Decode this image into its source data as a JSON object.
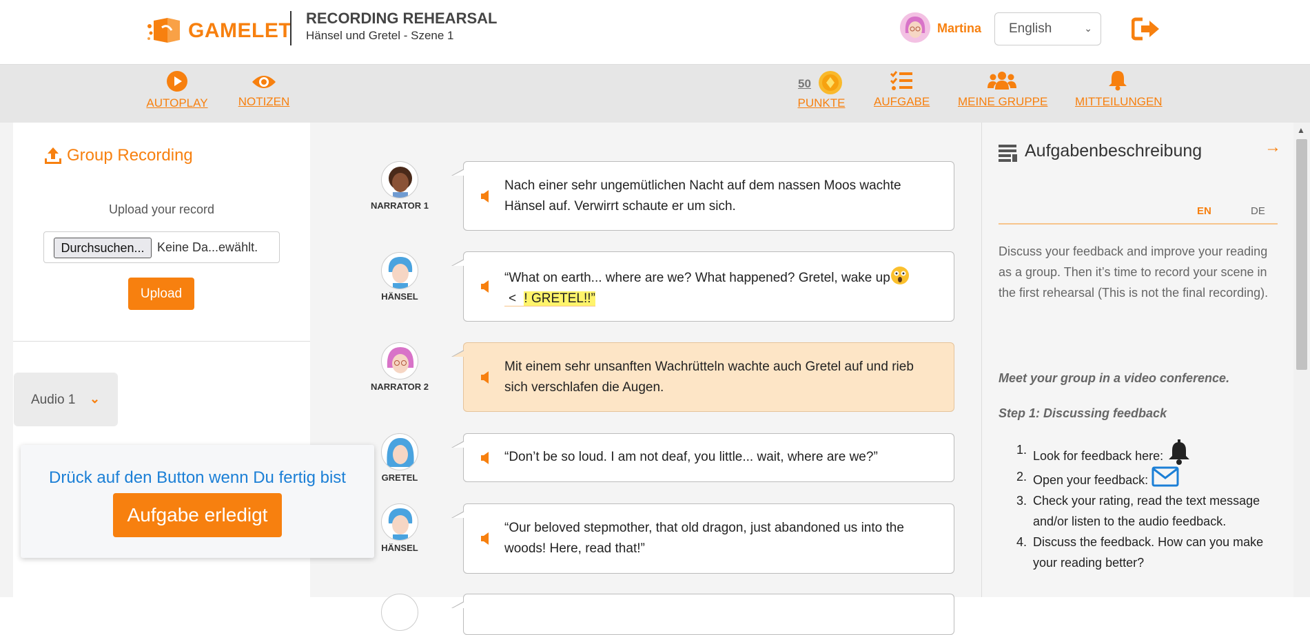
{
  "header": {
    "logo_text": "GAMELET",
    "title": "RECORDING REHEARSAL",
    "subtitle": "Hänsel und Gretel - Szene 1",
    "user_name": "Martina",
    "language": "English"
  },
  "nav": {
    "autoplay": "AUTOPLAY",
    "notes": "NOTIZEN",
    "points_value": "50",
    "points": "PUNKTE",
    "task": "AUFGABE",
    "group": "MEINE GRUPPE",
    "notifications": "MITTEILUNGEN"
  },
  "left": {
    "title": "Group Recording",
    "upload_label": "Upload your record",
    "browse_button": "Durchsuchen...",
    "file_status": "Keine Da...ewählt.",
    "upload_button": "Upload",
    "audio_select": "Audio 1",
    "done_prompt": "Drück auf den Button wenn Du fertig bist",
    "done_button": "Aufgabe erledigt"
  },
  "dialogue": [
    {
      "speaker": "NARRATOR 1",
      "text": "Nach einer sehr ungemütlichen Nacht auf dem nassen Moos wachte Hänsel auf. Verwirrt schaute er um sich."
    },
    {
      "speaker": "HÄNSEL",
      "text": "“What on earth... where are we? What happened? Gretel, wake up",
      "text_cont": "<",
      "highlight": "! GRETEL!!”"
    },
    {
      "speaker": "NARRATOR 2",
      "text": "Mit einem sehr unsanften Wachrütteln wachte auch Gretel auf und rieb sich verschlafen die Augen."
    },
    {
      "speaker": "GRETEL",
      "text": "“Don’t be so loud. I am not deaf, you little... wait, where are we?”"
    },
    {
      "speaker": "HÄNSEL",
      "text": "“Our beloved stepmother, that old dragon, just abandoned us into the woods! Here, read that!”"
    }
  ],
  "right": {
    "title": "Aufgabenbeschreibung",
    "tab_en": "EN",
    "tab_de": "DE",
    "description": "Discuss your feedback and improve your reading as a group. Then it’s time to record your scene in the first rehearsal (This is not the final recording).",
    "meet": "Meet your group in a video conference.",
    "step1": "Step 1: Discussing feedback",
    "steps": [
      "Look for feedback here:",
      "Open your feedback:",
      "Check your rating, read the text message and/or listen to the audio feedback.",
      "Discuss the feedback. How can you make your reading better?"
    ]
  },
  "colors": {
    "accent": "#f7800f",
    "highlight_row": "#fde5c6",
    "link_blue": "#1b7fd6"
  }
}
